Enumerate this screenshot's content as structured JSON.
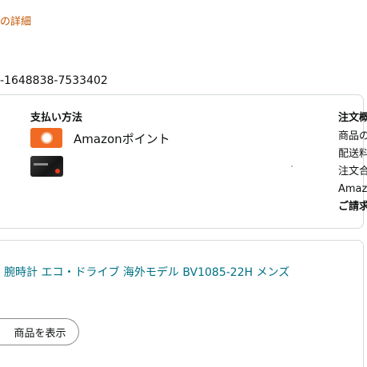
{
  "header": {
    "breadcrumb": "の詳細"
  },
  "order": {
    "number": "-1648838-7533402"
  },
  "payment": {
    "title": "支払い方法",
    "methods": [
      {
        "label": "Amazonポイント",
        "icon": "amazon-points-icon"
      },
      {
        "label": "",
        "icon": "credit-card-icon"
      }
    ]
  },
  "summary": {
    "title": "注文概",
    "rows": [
      "商品の",
      "配送料",
      "注文合",
      "Amaz"
    ],
    "total_label": "ご請求"
  },
  "item": {
    "title": "腕時計 エコ・ドライブ 海外モデル BV1085-22H メンズ",
    "view_button_label": "商品を表示"
  },
  "colors": {
    "link": "#007185",
    "breadcrumb": "#c45500",
    "points_icon": "#f06a23",
    "border": "#d5d9d9"
  }
}
